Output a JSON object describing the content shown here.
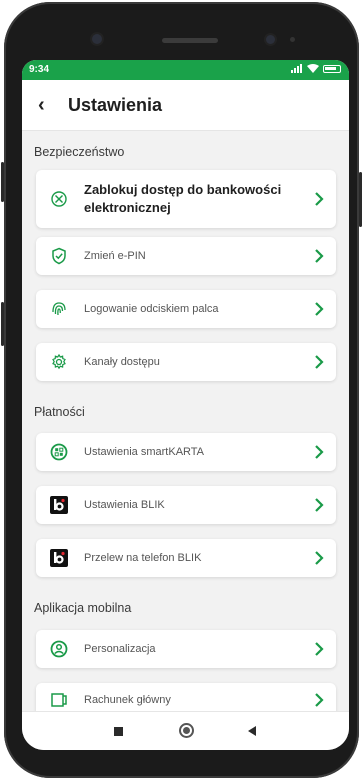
{
  "status_bar": {
    "time": "9:34",
    "icons": [
      "signal-icon",
      "wifi-icon",
      "battery-icon"
    ]
  },
  "header": {
    "back_icon": "‹",
    "title": "Ustawienia"
  },
  "colors": {
    "brand_green": "#1aa24a",
    "accent_green": "#1a9a48"
  },
  "sections": [
    {
      "label": "Bezpieczeństwo",
      "items": [
        {
          "label": "Zablokuj dostęp do bankowości elektronicznej",
          "icon": "block-icon"
        },
        {
          "label": "Zmień e-PIN",
          "icon": "shield-check-icon"
        },
        {
          "label": "Logowanie odciskiem palca",
          "icon": "fingerprint-icon"
        },
        {
          "label": "Kanały dostępu",
          "icon": "gear-icon"
        }
      ]
    },
    {
      "label": "Płatności",
      "items": [
        {
          "label": "Ustawienia smartKARTA",
          "icon": "smartkarta-icon"
        },
        {
          "label": "Ustawienia BLIK",
          "icon": "blik-icon"
        },
        {
          "label": "Przelew na telefon BLIK",
          "icon": "blik-icon"
        }
      ]
    },
    {
      "label": "Aplikacja mobilna",
      "items": [
        {
          "label": "Personalizacja",
          "icon": "user-circle-icon"
        },
        {
          "label": "Rachunek główny",
          "icon": "account-icon"
        }
      ]
    }
  ]
}
